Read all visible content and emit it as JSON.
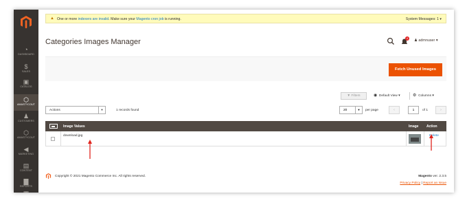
{
  "nav": {
    "items": [
      {
        "label": "DASHBOARD",
        "icon": "dashboard-icon",
        "glyph": "◔"
      },
      {
        "label": "SALES",
        "icon": "dollar-icon",
        "glyph": "$"
      },
      {
        "label": "CATALOG",
        "icon": "cube-icon",
        "glyph": "▣"
      },
      {
        "label": "AMASTYCOUT",
        "icon": "hexagon-icon",
        "glyph": "⬡"
      },
      {
        "label": "CUSTOMERS",
        "icon": "person-icon",
        "glyph": "♟"
      },
      {
        "label": "AMASTYCOUT",
        "icon": "hexagon-icon",
        "glyph": "⬡"
      },
      {
        "label": "MARKETING",
        "icon": "megaphone-icon",
        "glyph": "◀"
      },
      {
        "label": "CONTENT",
        "icon": "content-icon",
        "glyph": "▤"
      },
      {
        "label": "REPORTS",
        "icon": "bar-chart-icon",
        "glyph": "▇"
      },
      {
        "label": "",
        "icon": "stores-icon",
        "glyph": "▦"
      }
    ]
  },
  "message": {
    "prefix": "One or more",
    "link1": "indexers are invalid",
    "middle": ". Make sure your",
    "link2": "Magento cron job",
    "suffix": "is running.",
    "system": "System Messages: 1"
  },
  "header": {
    "title": "Categories Images Manager",
    "user": "admnuser",
    "notifications": "4"
  },
  "action_bar": {
    "fetch_label": "Fetch Unused Images"
  },
  "toolbar": {
    "filters": "Filters",
    "default_view": "Default View",
    "columns": "Columns",
    "actions": "Actions",
    "records": "1 records found",
    "per_page_value": "20",
    "per_page_label": "per page",
    "page": "1",
    "of_pages": "of 1"
  },
  "grid": {
    "headers": [
      "Image Values",
      "Image",
      "Action"
    ],
    "rows": [
      {
        "value": "download.jpg",
        "action": "Delete"
      }
    ]
  },
  "footer": {
    "copyright": "Copyright © 2021 Magento Commerce Inc. All rights reserved.",
    "brand": "Magento",
    "version": "ver. 2.3.5",
    "privacy": "Privacy Policy",
    "divider": "|",
    "report": "Report an Issue"
  },
  "colors": {
    "sidebar": "#373330",
    "accent": "#eb5202",
    "link": "#1979c3",
    "grid_header": "#514943",
    "annotation_arrow": "#e0231c"
  }
}
